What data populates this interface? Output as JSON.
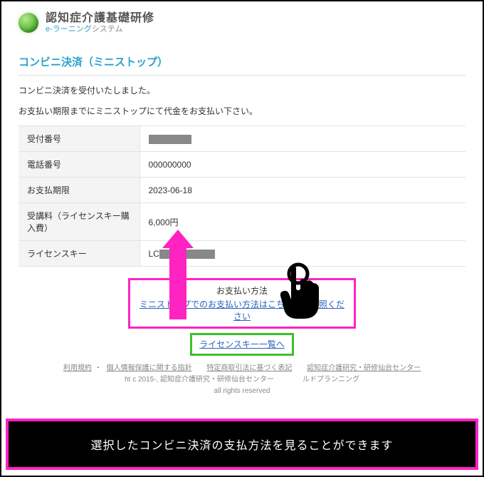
{
  "header": {
    "title": "認知症介護基礎研修",
    "sub_accent": "e-ラーニング",
    "sub_rest": "システム"
  },
  "page_title": "コンビニ決済（ミニストップ）",
  "messages": {
    "accepted": "コンビニ決済を受付いたしました。",
    "instruct": "お支払い期限までにミニストップにて代金をお支払い下さい。"
  },
  "table": {
    "rows": [
      {
        "label": "受付番号",
        "value": ""
      },
      {
        "label": "電話番号",
        "value": "000000000"
      },
      {
        "label": "お支払期限",
        "value": "2023-06-18"
      },
      {
        "label": "受講料（ライセンスキー購入費）",
        "value": "6,000円"
      },
      {
        "label": "ライセンスキー",
        "value_prefix": "LC"
      }
    ]
  },
  "payment_box": {
    "label": "お支払い方法",
    "link_text": "ミニストップでのお支払い方法はこちらをご参照ください"
  },
  "license_link": {
    "text": "ライセンスキー一覧へ"
  },
  "footer": {
    "links": [
      "利用規約",
      "個人情報保護に関する指針",
      "特定商取引法に基づく表記",
      "認知症介護研究・研修仙台センター"
    ],
    "copyright_line": "ht c 2015-, 認知症介護研究・研修仙台センター　　　　ルドプランニング",
    "rights": "all rights reserved"
  },
  "caption": "選択したコンビニ決済の支払方法を見ることができます"
}
